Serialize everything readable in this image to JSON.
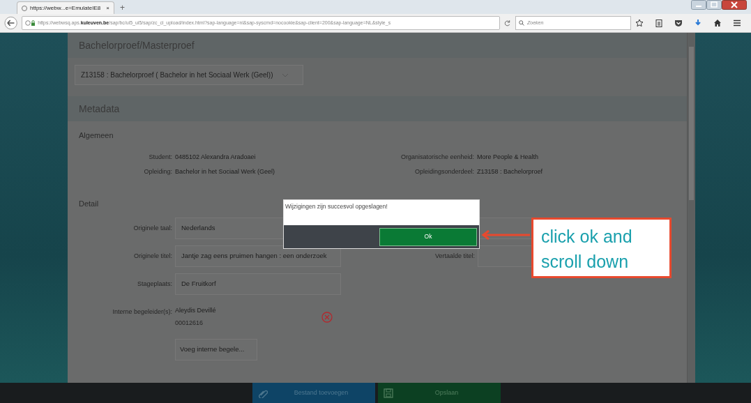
{
  "browser": {
    "tab_title": "https://webw...e=EmulateIE8",
    "tab_close": "×",
    "new_tab": "+",
    "url_prefix": "https://webwsq.aps.",
    "url_domain": "kuleuven.be",
    "url_rest": "/sap/bc/ui5_ui5/sap/zc_ci_upload/index.html?sap-language=nl&sap-syscmd=nocookie&sap-client=200&sap-language=NL&style_s",
    "search_placeholder": "Zoeken"
  },
  "section_title": "Bachelorproef/Masterproef",
  "program_select": {
    "value": "Z13158 : Bachelorproef ( Bachelor in het Sociaal Werk (Geel))"
  },
  "metadata_title": "Metadata",
  "general": {
    "heading": "Algemeen",
    "left": [
      {
        "label": "Student:",
        "value": "0485102 Alexandra Aradoaei"
      },
      {
        "label": "Opleiding:",
        "value": "Bachelor in het Sociaal Werk (Geel)"
      }
    ],
    "right": [
      {
        "label": "Organisatorische eenheid:",
        "value": "More People & Health"
      },
      {
        "label": "Opleidingsonderdeel:",
        "value": "Z13158 : Bachelorproef"
      }
    ]
  },
  "detail": {
    "heading": "Detail",
    "rows": [
      {
        "label": "Originele taal:",
        "value": "Nederlands",
        "right": {
          "kind": "field"
        }
      },
      {
        "label": "Originele titel:",
        "value": "Jantje zag eens pruimen hangen : een onderzoek",
        "right": {
          "kind": "field",
          "label": "Vertaalde titel:"
        }
      },
      {
        "label": "Stageplaats:",
        "value": "De Fruitkorf"
      }
    ],
    "supervisors": {
      "label": "Interne begeleider(s):",
      "name": "Aleydis Devillé",
      "id": "00012616",
      "add_button": "Voeg interne begele..."
    }
  },
  "footer_buttons": [
    {
      "kind": "attach",
      "label": "Bestand toevoegen"
    },
    {
      "kind": "save",
      "label": "Opslaan"
    }
  ],
  "dialog": {
    "message": "Wijzigingen zijn succesvol opgeslagen!",
    "button": "Ok"
  },
  "callout": {
    "lines": [
      "click ok and",
      "scroll down"
    ]
  }
}
